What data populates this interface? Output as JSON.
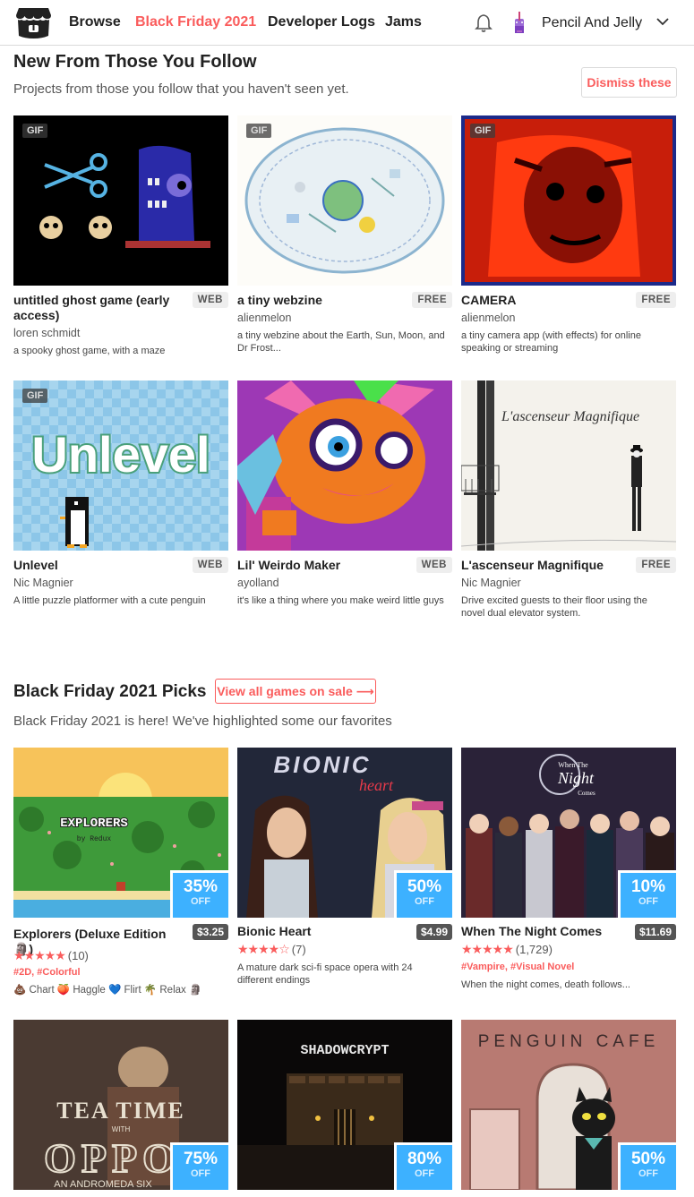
{
  "header": {
    "nav": [
      "Browse",
      "Black Friday 2021",
      "Developer Logs",
      "Jams"
    ],
    "username": "Pencil And Jelly"
  },
  "follow": {
    "title": "New From Those You Follow",
    "subtitle": "Projects from those you follow that you haven't seen yet.",
    "dismiss_label": "Dismiss these",
    "cards": [
      {
        "title": "untitled ghost game (early access)",
        "tag": "WEB",
        "author": "loren schmidt",
        "desc": "a spooky ghost game, with a maze",
        "gif": "GIF"
      },
      {
        "title": "a tiny webzine",
        "tag": "FREE",
        "author": "alienmelon",
        "desc": "a tiny webzine about the Earth, Sun, Moon, and Dr Frost...",
        "gif": "GIF"
      },
      {
        "title": "CAMERA",
        "tag": "FREE",
        "author": "alienmelon",
        "desc": "a tiny camera app (with effects) for online speaking or streaming",
        "gif": "GIF"
      },
      {
        "title": "Unlevel",
        "tag": "WEB",
        "author": "Nic Magnier",
        "desc": "A little puzzle platformer with a cute penguin",
        "gif": "GIF",
        "thumb_text": "Unlevel"
      },
      {
        "title": "Lil' Weirdo Maker",
        "tag": "WEB",
        "author": "ayolland",
        "desc": "it's like a thing where you make weird little guys"
      },
      {
        "title": "L'ascenseur Magnifique",
        "tag": "FREE",
        "author": "Nic Magnier",
        "desc": "Drive excited guests to their floor using the novel dual elevator system.",
        "thumb_text": "L'ascenseur Magnifique"
      }
    ]
  },
  "bf": {
    "title": "Black Friday 2021 Picks",
    "view_all_label": "View all games on sale ⟶",
    "subtitle": "Black Friday 2021 is here! We've highlighted some our favorites",
    "off_label": "OFF",
    "cards": [
      {
        "title": "Explorers (Deluxe Edition 🗿)",
        "price": "$3.25",
        "discount": "35%",
        "stars": "★★★★★",
        "count": "(10)",
        "tags": "#2D, #Colorful",
        "extras": "💩 Chart 🍑 Haggle 💙 Flirt 🌴 Relax 🗿",
        "thumb_text": "EXPLORERS",
        "thumb_sub": "by Redux"
      },
      {
        "title": "Bionic Heart",
        "price": "$4.99",
        "discount": "50%",
        "stars": "★★★★☆",
        "count": "(7)",
        "desc": "A mature dark sci-fi space opera with 24 different endings",
        "thumb_text": "BIONIC",
        "thumb_sub": "heart"
      },
      {
        "title": "When The Night Comes",
        "price": "$11.69",
        "discount": "10%",
        "stars": "★★★★★",
        "count": "(1,729)",
        "tags": "#Vampire, #Visual Novel",
        "desc": "When the night comes, death follows...",
        "thumb_text": "When The",
        "thumb_text2": "Night",
        "thumb_text3": "Comes"
      },
      {
        "discount": "75%",
        "thumb_text": "TEA TIME",
        "thumb_text2": "WITH",
        "thumb_text3": "OPPO",
        "thumb_sub": "AN ANDROMEDA SIX"
      },
      {
        "discount": "80%",
        "thumb_text": "SHADOWCRYPT"
      },
      {
        "discount": "50%",
        "thumb_text": "PENGUIN CAFE"
      }
    ]
  }
}
